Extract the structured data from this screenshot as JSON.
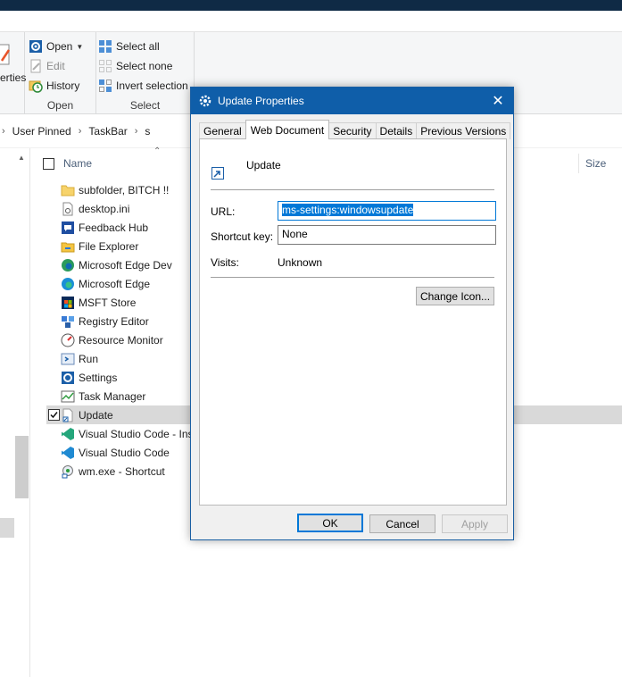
{
  "window": {
    "ribbon_left_cut_label": "erties"
  },
  "ribbon": {
    "open_group": {
      "label": "Open",
      "buttons": [
        {
          "label": "Open",
          "icon": "properties-icon",
          "has_dropdown": true
        },
        {
          "label": "Edit",
          "icon": "edit-icon",
          "disabled": true
        },
        {
          "label": "History",
          "icon": "history-icon"
        }
      ]
    },
    "select_group": {
      "label": "Select",
      "buttons": [
        {
          "label": "Select all",
          "icon": "select-all-icon"
        },
        {
          "label": "Select none",
          "icon": "select-none-icon"
        },
        {
          "label": "Invert selection",
          "icon": "invert-selection-icon"
        }
      ]
    }
  },
  "address": {
    "crumbs": [
      "User Pinned",
      "TaskBar",
      "s"
    ]
  },
  "file_list": {
    "columns": {
      "name": "Name",
      "size": "Size"
    },
    "items": [
      {
        "name": "subfolder, BITCH !!",
        "icon": "folder-icon"
      },
      {
        "name": "desktop.ini",
        "icon": "settings-file-icon"
      },
      {
        "name": "Feedback Hub",
        "icon": "feedback-hub-icon"
      },
      {
        "name": "File Explorer",
        "icon": "file-explorer-icon"
      },
      {
        "name": "Microsoft Edge Dev",
        "icon": "edge-dev-icon"
      },
      {
        "name": "Microsoft Edge",
        "icon": "edge-icon"
      },
      {
        "name": "MSFT Store",
        "icon": "store-icon"
      },
      {
        "name": "Registry Editor",
        "icon": "registry-editor-icon"
      },
      {
        "name": "Resource Monitor",
        "icon": "resource-monitor-icon"
      },
      {
        "name": "Run",
        "icon": "run-icon"
      },
      {
        "name": "Settings",
        "icon": "settings-gear-icon"
      },
      {
        "name": "Task Manager",
        "icon": "task-manager-icon"
      },
      {
        "name": "Update",
        "icon": "update-shortcut-icon",
        "selected": true,
        "checked": true
      },
      {
        "name": "Visual Studio Code - Insiders",
        "icon": "vscode-insiders-icon"
      },
      {
        "name": "Visual Studio Code",
        "icon": "vscode-icon"
      },
      {
        "name": "wm.exe - Shortcut",
        "icon": "wm-exe-icon"
      }
    ]
  },
  "dialog": {
    "title": "Update Properties",
    "close_glyph": "✕",
    "tabs": [
      "General",
      "Web Document",
      "Security",
      "Details",
      "Previous Versions"
    ],
    "active_tab": "Web Document",
    "item_name": "Update",
    "url_label": "URL:",
    "url_value": "ms-settings:windowsupdate",
    "shortcut_key_label": "Shortcut key:",
    "shortcut_key_value": "None",
    "visits_label": "Visits:",
    "visits_value": "Unknown",
    "change_icon_button": "Change Icon...",
    "ok_button": "OK",
    "cancel_button": "Cancel",
    "apply_button": "Apply"
  },
  "colors": {
    "accent": "#0078d7",
    "title_bar": "#0f5ea9",
    "selection_row": "#d9d9d9"
  }
}
